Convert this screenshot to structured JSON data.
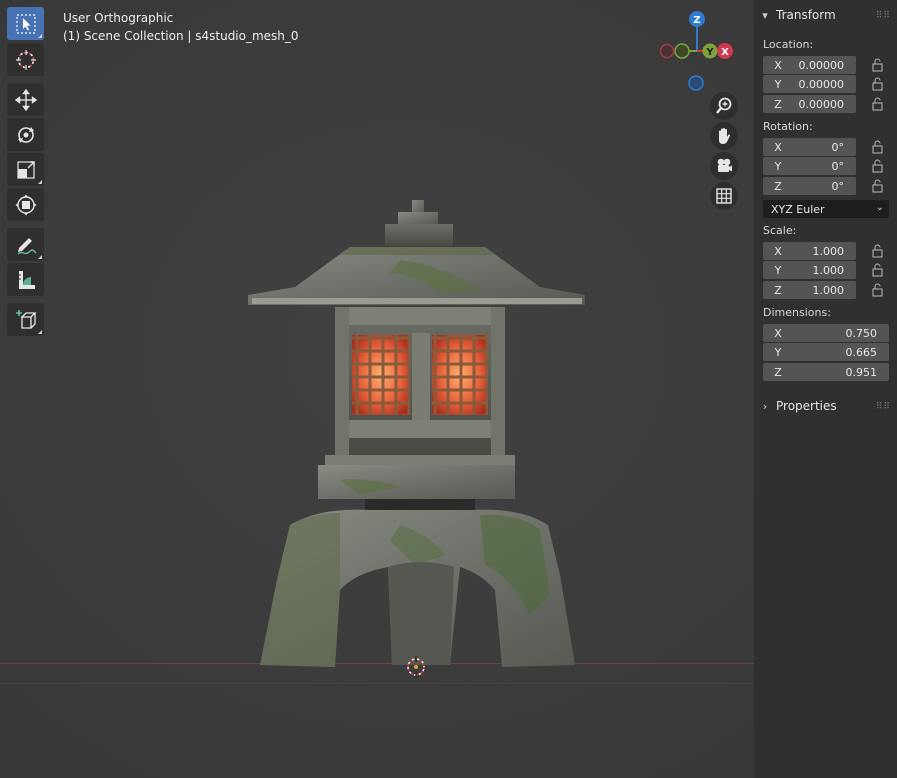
{
  "viewport": {
    "view_name": "User Orthographic",
    "collection_path": "(1) Scene Collection | s4studio_mesh_0"
  },
  "toolbar": {
    "tools": [
      {
        "name": "select-box",
        "icon": "cursor-select-icon",
        "active": true
      },
      {
        "name": "cursor",
        "icon": "3d-cursor-icon",
        "active": false
      },
      {
        "name": "move",
        "icon": "move-arrows-icon",
        "active": false
      },
      {
        "name": "rotate",
        "icon": "rotate-icon",
        "active": false
      },
      {
        "name": "scale",
        "icon": "scale-icon",
        "active": false
      },
      {
        "name": "transform",
        "icon": "transform-icon",
        "active": false
      },
      {
        "name": "annotate",
        "icon": "annotate-pencil-icon",
        "active": false
      },
      {
        "name": "measure",
        "icon": "measure-ruler-icon",
        "active": false
      },
      {
        "name": "add-cube",
        "icon": "add-cube-icon",
        "active": false
      }
    ]
  },
  "gizmo": {
    "z_label": "Z",
    "y_label": "Y",
    "x_label": "X",
    "colors": {
      "z": "#2f7bd1",
      "y": "#7ea33a",
      "x": "#d0384f"
    }
  },
  "nav_buttons": [
    "zoom-icon",
    "hand-pan-icon",
    "camera-icon",
    "grid-icon"
  ],
  "sidebar": {
    "transform_title": "Transform",
    "location_label": "Location:",
    "location": [
      {
        "axis": "X",
        "value": "0.00000"
      },
      {
        "axis": "Y",
        "value": "0.00000"
      },
      {
        "axis": "Z",
        "value": "0.00000"
      }
    ],
    "rotation_label": "Rotation:",
    "rotation": [
      {
        "axis": "X",
        "value": "0°"
      },
      {
        "axis": "Y",
        "value": "0°"
      },
      {
        "axis": "Z",
        "value": "0°"
      }
    ],
    "rotation_mode": "XYZ Euler",
    "scale_label": "Scale:",
    "scale": [
      {
        "axis": "X",
        "value": "1.000"
      },
      {
        "axis": "Y",
        "value": "1.000"
      },
      {
        "axis": "Z",
        "value": "1.000"
      }
    ],
    "dimensions_label": "Dimensions:",
    "dimensions": [
      {
        "axis": "X",
        "value": "0.750"
      },
      {
        "axis": "Y",
        "value": "0.665"
      },
      {
        "axis": "Z",
        "value": "0.951"
      }
    ],
    "properties_title": "Properties"
  }
}
